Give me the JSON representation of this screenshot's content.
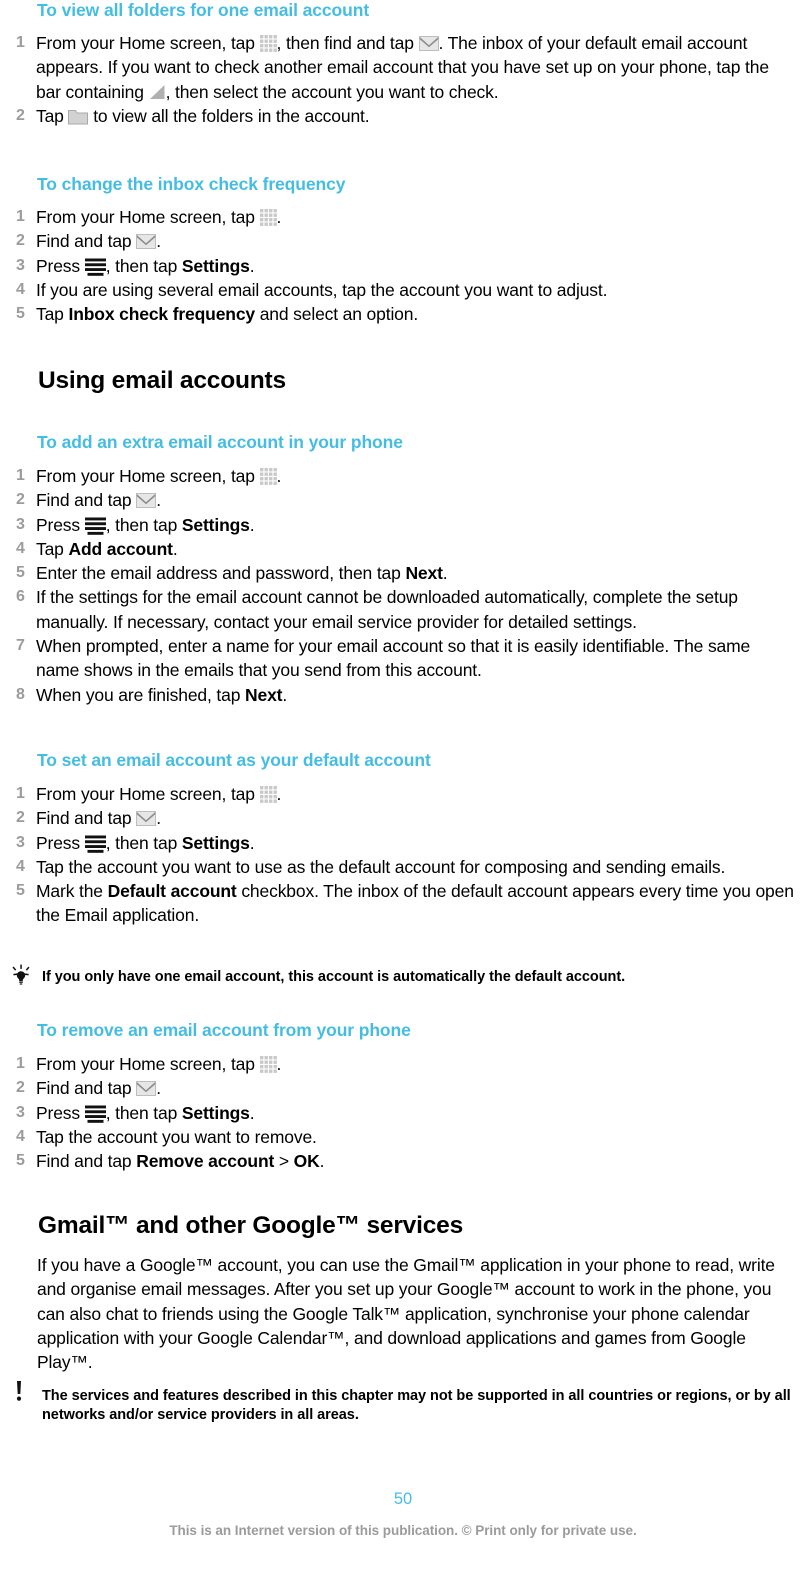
{
  "theme": {
    "heading_color": "#45BDE3",
    "body_color": "#000000",
    "step_number_color": "#9b9b9b",
    "footer_color": "#9b9b9b",
    "page_number_color": "#45BDE3",
    "background": "#ffffff"
  },
  "sections": [
    {
      "id": "view-all-folders",
      "type": "procedure",
      "heading": "To view all folders for one email account",
      "steps": [
        {
          "number": "1",
          "parts": [
            {
              "t": "text",
              "v": "From your Home screen, tap "
            },
            {
              "t": "icon",
              "v": "apps-grid-icon"
            },
            {
              "t": "text",
              "v": ", then find and tap "
            },
            {
              "t": "icon",
              "v": "email-envelope-icon"
            },
            {
              "t": "text",
              "v": ". The inbox of your default email account appears. If you want to check another email account that you have set up on your phone, tap the bar containing "
            },
            {
              "t": "icon",
              "v": "triangle-indicator-icon"
            },
            {
              "t": "text",
              "v": ", then select the account you want to check."
            }
          ]
        },
        {
          "number": "2",
          "parts": [
            {
              "t": "text",
              "v": "Tap "
            },
            {
              "t": "icon",
              "v": "folder-icon"
            },
            {
              "t": "text",
              "v": " to view all the folders in the account."
            }
          ]
        }
      ]
    },
    {
      "id": "change-inbox-check-frequency",
      "type": "procedure",
      "heading": "To change the inbox check frequency",
      "steps": [
        {
          "number": "1",
          "parts": [
            {
              "t": "text",
              "v": "From your Home screen, tap "
            },
            {
              "t": "icon",
              "v": "apps-grid-icon"
            },
            {
              "t": "text",
              "v": "."
            }
          ]
        },
        {
          "number": "2",
          "parts": [
            {
              "t": "text",
              "v": "Find and tap "
            },
            {
              "t": "icon",
              "v": "email-envelope-icon"
            },
            {
              "t": "text",
              "v": "."
            }
          ]
        },
        {
          "number": "3",
          "parts": [
            {
              "t": "text",
              "v": "Press "
            },
            {
              "t": "icon",
              "v": "menu-icon"
            },
            {
              "t": "text",
              "v": ", then tap "
            },
            {
              "t": "bold",
              "v": "Settings"
            },
            {
              "t": "text",
              "v": "."
            }
          ]
        },
        {
          "number": "4",
          "parts": [
            {
              "t": "text",
              "v": "If you are using several email accounts, tap the account you want to adjust."
            }
          ]
        },
        {
          "number": "5",
          "parts": [
            {
              "t": "text",
              "v": "Tap "
            },
            {
              "t": "bold",
              "v": "Inbox check frequency"
            },
            {
              "t": "text",
              "v": " and select an option."
            }
          ]
        }
      ]
    },
    {
      "id": "using-email-accounts",
      "type": "chapter-heading",
      "heading": "Using email accounts"
    },
    {
      "id": "add-extra-email-account",
      "type": "procedure",
      "heading": "To add an extra email account in your phone",
      "steps": [
        {
          "number": "1",
          "parts": [
            {
              "t": "text",
              "v": "From your Home screen, tap "
            },
            {
              "t": "icon",
              "v": "apps-grid-icon"
            },
            {
              "t": "text",
              "v": "."
            }
          ]
        },
        {
          "number": "2",
          "parts": [
            {
              "t": "text",
              "v": "Find and tap "
            },
            {
              "t": "icon",
              "v": "email-envelope-icon"
            },
            {
              "t": "text",
              "v": "."
            }
          ]
        },
        {
          "number": "3",
          "parts": [
            {
              "t": "text",
              "v": "Press "
            },
            {
              "t": "icon",
              "v": "menu-icon"
            },
            {
              "t": "text",
              "v": ", then tap "
            },
            {
              "t": "bold",
              "v": "Settings"
            },
            {
              "t": "text",
              "v": "."
            }
          ]
        },
        {
          "number": "4",
          "parts": [
            {
              "t": "text",
              "v": "Tap "
            },
            {
              "t": "bold",
              "v": "Add account"
            },
            {
              "t": "text",
              "v": "."
            }
          ]
        },
        {
          "number": "5",
          "parts": [
            {
              "t": "text",
              "v": "Enter the email address and password, then tap "
            },
            {
              "t": "bold",
              "v": "Next"
            },
            {
              "t": "text",
              "v": "."
            }
          ]
        },
        {
          "number": "6",
          "parts": [
            {
              "t": "text",
              "v": "If the settings for the email account cannot be downloaded automatically, complete the setup manually. If necessary, contact your email service provider for detailed settings."
            }
          ]
        },
        {
          "number": "7",
          "parts": [
            {
              "t": "text",
              "v": "When prompted, enter a name for your email account so that it is easily identifiable. The same name shows in the emails that you send from this account."
            }
          ]
        },
        {
          "number": "8",
          "parts": [
            {
              "t": "text",
              "v": "When you are finished, tap "
            },
            {
              "t": "bold",
              "v": "Next"
            },
            {
              "t": "text",
              "v": "."
            }
          ]
        }
      ]
    },
    {
      "id": "set-default-account",
      "type": "procedure",
      "heading": "To set an email account as your default account",
      "steps": [
        {
          "number": "1",
          "parts": [
            {
              "t": "text",
              "v": "From your Home screen, tap "
            },
            {
              "t": "icon",
              "v": "apps-grid-icon"
            },
            {
              "t": "text",
              "v": "."
            }
          ]
        },
        {
          "number": "2",
          "parts": [
            {
              "t": "text",
              "v": "Find and tap "
            },
            {
              "t": "icon",
              "v": "email-envelope-icon"
            },
            {
              "t": "text",
              "v": "."
            }
          ]
        },
        {
          "number": "3",
          "parts": [
            {
              "t": "text",
              "v": "Press "
            },
            {
              "t": "icon",
              "v": "menu-icon"
            },
            {
              "t": "text",
              "v": ", then tap "
            },
            {
              "t": "bold",
              "v": "Settings"
            },
            {
              "t": "text",
              "v": "."
            }
          ]
        },
        {
          "number": "4",
          "parts": [
            {
              "t": "text",
              "v": "Tap the account you want to use as the default account for composing and sending emails."
            }
          ]
        },
        {
          "number": "5",
          "parts": [
            {
              "t": "text",
              "v": "Mark the "
            },
            {
              "t": "bold",
              "v": "Default account"
            },
            {
              "t": "text",
              "v": " checkbox. The inbox of the default account appears every time you open the Email application."
            }
          ]
        }
      ]
    },
    {
      "id": "tip-default-account",
      "type": "tip",
      "icon": "tip-lightbulb-icon",
      "text": "If you only have one email account, this account is automatically the default account."
    },
    {
      "id": "remove-email-account",
      "type": "procedure",
      "heading": "To remove an email account from your phone",
      "steps": [
        {
          "number": "1",
          "parts": [
            {
              "t": "text",
              "v": "From your Home screen, tap "
            },
            {
              "t": "icon",
              "v": "apps-grid-icon"
            },
            {
              "t": "text",
              "v": "."
            }
          ]
        },
        {
          "number": "2",
          "parts": [
            {
              "t": "text",
              "v": "Find and tap "
            },
            {
              "t": "icon",
              "v": "email-envelope-icon"
            },
            {
              "t": "text",
              "v": "."
            }
          ]
        },
        {
          "number": "3",
          "parts": [
            {
              "t": "text",
              "v": "Press "
            },
            {
              "t": "icon",
              "v": "menu-icon"
            },
            {
              "t": "text",
              "v": ", then tap "
            },
            {
              "t": "bold",
              "v": "Settings"
            },
            {
              "t": "text",
              "v": "."
            }
          ]
        },
        {
          "number": "4",
          "parts": [
            {
              "t": "text",
              "v": "Tap the account you want to remove."
            }
          ]
        },
        {
          "number": "5",
          "parts": [
            {
              "t": "text",
              "v": "Find and tap "
            },
            {
              "t": "bold",
              "v": "Remove account"
            },
            {
              "t": "text",
              "v": " > "
            },
            {
              "t": "bold",
              "v": "OK"
            },
            {
              "t": "text",
              "v": "."
            }
          ]
        }
      ]
    },
    {
      "id": "gmail-and-google-services",
      "type": "chapter-heading",
      "heading": "Gmail™ and other Google™ services"
    },
    {
      "id": "gmail-body",
      "type": "paragraph",
      "text": "If you have a Google™ account, you can use the Gmail™ application in your phone to read, write and organise email messages. After you set up your Google™ account to work in the phone, you can also chat to friends using the Google Talk™ application, synchronise your phone calendar application with your Google Calendar™, and download applications and games from Google Play™."
    },
    {
      "id": "warning-services",
      "type": "warning",
      "icon": "warning-exclamation-icon",
      "text": "The services and features described in this chapter may not be supported in all countries or regions, or by all networks and/or service providers in all areas."
    }
  ],
  "footer": {
    "page_number": "50",
    "notice": "This is an Internet version of this publication. © Print only for private use."
  }
}
